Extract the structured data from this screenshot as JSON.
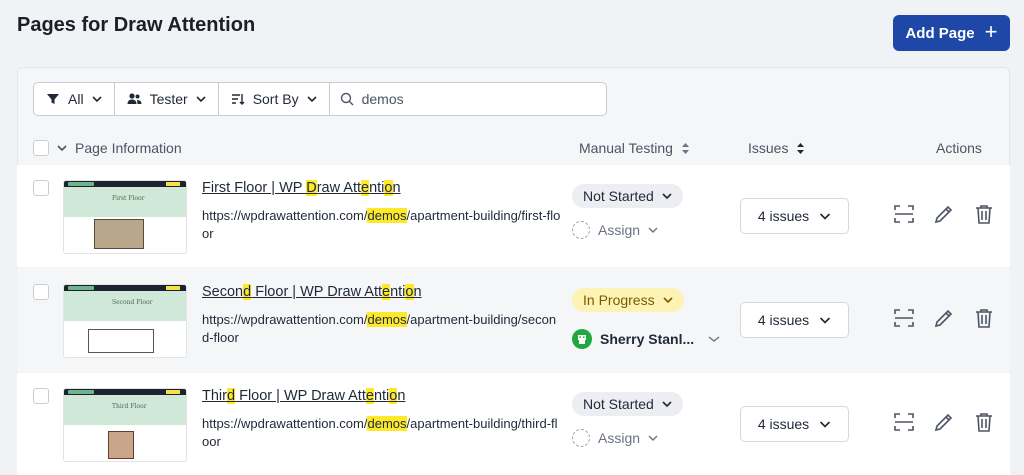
{
  "header": {
    "title": "Pages for Draw Attention",
    "add_label": "Add Page"
  },
  "filters": {
    "status_label": "All",
    "tester_label": "Tester",
    "sort_label": "Sort By",
    "search_value": "demos"
  },
  "columns": {
    "page_info": "Page Information",
    "manual_testing": "Manual Testing",
    "issues": "Issues",
    "actions": "Actions"
  },
  "rows": [
    {
      "title_parts": [
        "First Floor | WP ",
        "D",
        "raw Att",
        "e",
        "nti",
        "o",
        "n"
      ],
      "url_parts": [
        "https://wpdrawattention.com/",
        "demos",
        "/apartment-building/first-floor"
      ],
      "thumb_caption": "First Floor",
      "status": "Not Started",
      "assign_label": "Assign",
      "issues": "4 issues"
    },
    {
      "title_parts": [
        "Secon",
        "d",
        " Floor | WP Draw Att",
        "e",
        "nti",
        "o",
        "n"
      ],
      "url_parts": [
        "https://wpdrawattention.com/",
        "demos",
        "/apartment-building/second-floor"
      ],
      "thumb_caption": "Second Floor",
      "status": "In Progress",
      "assignee": "Sherry Stanl...",
      "issues": "4 issues"
    },
    {
      "title_parts": [
        "Thir",
        "d",
        " Floor | WP Draw Att",
        "e",
        "nti",
        "o",
        "n"
      ],
      "url_parts": [
        "https://wpdrawattention.com/",
        "demos",
        "/apartment-building/third-floor"
      ],
      "thumb_caption": "Third Floor",
      "status": "Not Started",
      "assign_label": "Assign",
      "issues": "4 issues"
    }
  ],
  "colors": {
    "primary": "#1f47a8",
    "highlight": "#fde92a",
    "in_progress_bg": "#fdf3b4",
    "avatar": "#1fa83e"
  }
}
